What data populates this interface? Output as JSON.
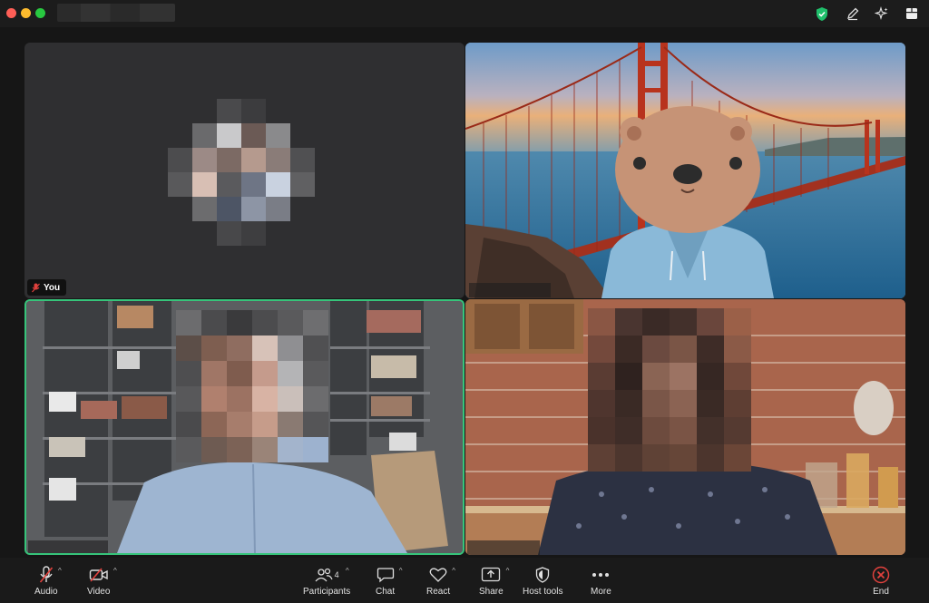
{
  "toolbar": {
    "audio": "Audio",
    "video": "Video",
    "participants": "Participants",
    "participants_count": "4",
    "chat": "Chat",
    "react": "React",
    "share": "Share",
    "host_tools": "Host tools",
    "more": "More",
    "end": "End"
  },
  "tiles": {
    "you_label": "You"
  },
  "colors": {
    "active_speaker_border": "#36c47a",
    "end_red": "#e0413d",
    "muted_red": "#e0413d",
    "shield_green": "#1fbf6b"
  },
  "icons": [
    "shield-icon",
    "pencil-icon",
    "sparkle-icon",
    "apps-icon",
    "microphone-muted-icon",
    "video-off-icon",
    "participants-icon",
    "chat-icon",
    "heart-icon",
    "share-icon",
    "host-shield-icon",
    "more-icon",
    "end-icon"
  ]
}
